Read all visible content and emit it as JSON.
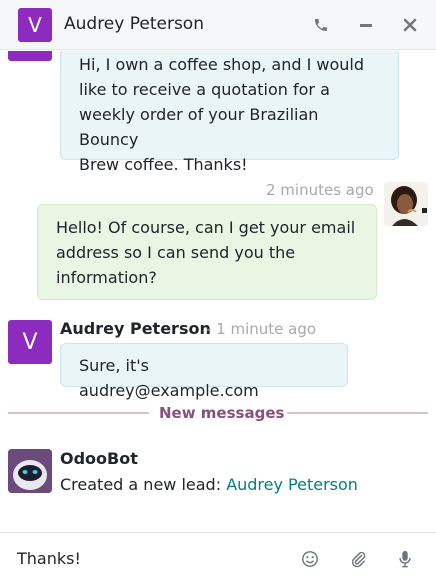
{
  "header": {
    "avatar_letter": "V",
    "title": "Audrey Peterson",
    "phone_icon": "phone-icon",
    "minimize_icon": "minimize-icon",
    "close_icon": "close-icon"
  },
  "messages": [
    {
      "id": "m1",
      "side": "left",
      "text_lines": [
        "Hi, I own a coffee shop, and I would",
        "like to receive a quotation for a",
        "weekly order of your Brazilian Bouncy",
        "Brew coffee. Thanks!"
      ]
    },
    {
      "id": "m2",
      "side": "right",
      "time": "2 minutes ago",
      "text_lines": [
        "Hello! Of course, can I get your email",
        "address so I can send you the",
        "information?"
      ]
    },
    {
      "id": "m3",
      "side": "left",
      "author": "Audrey Peterson",
      "time": "- 1 minute ago",
      "avatar_letter": "V",
      "text": "Sure, it's audrey@example.com"
    }
  ],
  "divider": {
    "label": "New messages"
  },
  "bot_message": {
    "author": "OdooBot",
    "text_prefix": "Created a new lead:",
    "link_text": "Audrey Peterson"
  },
  "composer": {
    "value": "Thanks!",
    "emoji_icon": "emoji-icon",
    "attach_icon": "paperclip-icon",
    "mic_icon": "microphone-icon"
  },
  "colors": {
    "avatar_purple": "#8e2bbf",
    "link_teal": "#017e84",
    "divider": "#d8bfd3",
    "divider_text": "#8a4f7d"
  }
}
